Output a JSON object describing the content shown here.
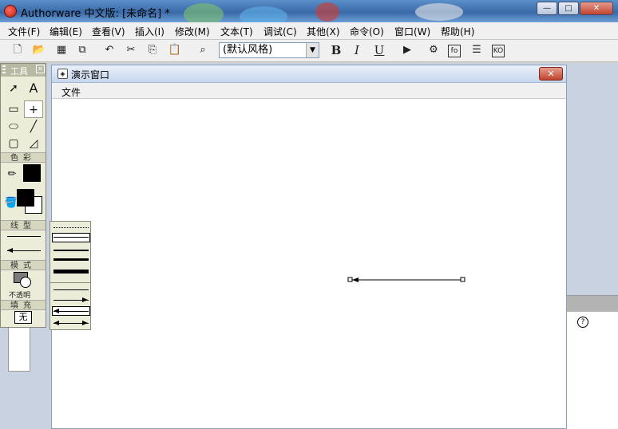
{
  "window": {
    "title": "Authorware 中文版: [未命名] *"
  },
  "window_buttons": {
    "minimize": "—",
    "maximize": "□",
    "close": "✕"
  },
  "menubar": [
    "文件(F)",
    "编辑(E)",
    "查看(V)",
    "插入(I)",
    "修改(M)",
    "文本(T)",
    "调试(C)",
    "其他(X)",
    "命令(O)",
    "窗口(W)",
    "帮助(H)"
  ],
  "toolbar": {
    "style_combo": "(默认风格)",
    "bold": "B",
    "italic": "I",
    "underline": "U",
    "icons": [
      "new-icon",
      "open-icon",
      "save-all-icon",
      "import-icon",
      "undo-icon",
      "cut-icon",
      "copy-icon",
      "paste-icon",
      "find-icon",
      "run-icon",
      "control-panel-icon",
      "functions-icon",
      "variables-icon",
      "knowledge-objects-icon"
    ],
    "boxed_labels": [
      "fo",
      "KO"
    ]
  },
  "presentation_window": {
    "title": "演示窗口",
    "menu": "文件",
    "close": "✕"
  },
  "tools": {
    "title": "工具",
    "sections": {
      "color": "色彩",
      "line": "线型",
      "mode": "模式",
      "fill": "填充"
    },
    "mode_value": "不透明",
    "fill_value": "无",
    "text_tool": "A"
  },
  "colors": {
    "stroke": "#000000",
    "fill_fore": "#000000",
    "fill_back": "#ffffff",
    "accent": "#3a6aa8"
  },
  "help_icon": "?"
}
